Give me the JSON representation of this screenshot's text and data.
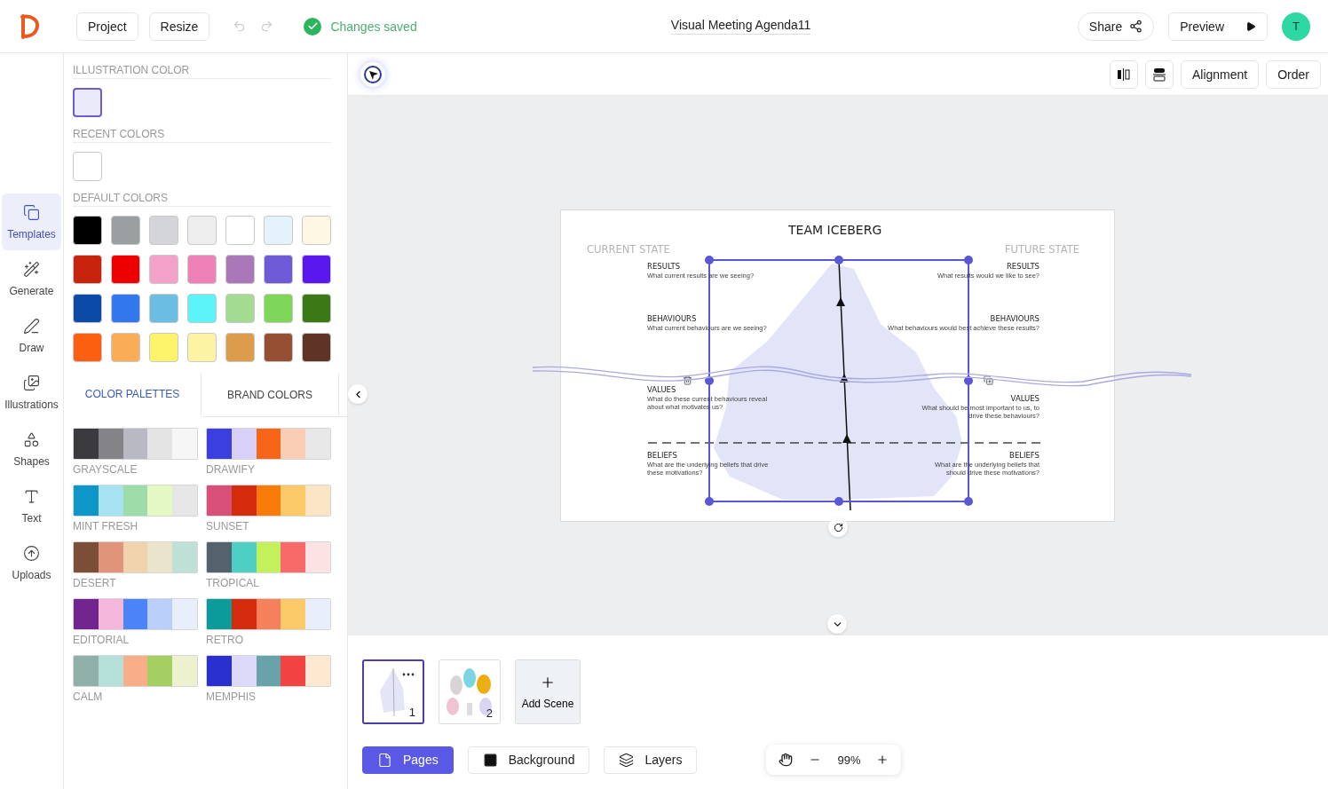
{
  "header": {
    "project_button": "Project",
    "resize_button": "Resize",
    "status": "Changes saved",
    "document_title": "Visual Meeting Agenda11",
    "share_button": "Share",
    "preview_button": "Preview",
    "avatar": "T"
  },
  "sidebar": {
    "items": [
      {
        "label": "Templates",
        "selected": true
      },
      {
        "label": "Generate",
        "selected": false
      },
      {
        "label": "Draw",
        "selected": false
      },
      {
        "label": "Illustrations",
        "selected": false
      },
      {
        "label": "Shapes",
        "selected": false
      },
      {
        "label": "Text",
        "selected": false
      },
      {
        "label": "Uploads",
        "selected": false
      }
    ]
  },
  "color_panel": {
    "illustration_heading": "ILLUSTRATION COLOR",
    "illustration_colors": [
      {
        "color": "#e9e9f9"
      }
    ],
    "recent_heading": "RECENT COLORS",
    "recent_colors": [
      {
        "color": "#ffffff"
      }
    ],
    "default_heading": "DEFAULT COLORS",
    "default_colors": [
      {
        "color": "#000000"
      },
      {
        "color": "#9aa0a2"
      },
      {
        "color": "#d3d5d8"
      },
      {
        "color": "#eeeeee"
      },
      {
        "color": "#ffffff"
      },
      {
        "color": "#e3f2fb"
      },
      {
        "color": "#fdf7e4"
      },
      {
        "color": "#c8230c"
      },
      {
        "color": "#ee0000"
      },
      {
        "color": "#f2a2c8"
      },
      {
        "color": "#ee82b8"
      },
      {
        "color": "#aa78b8"
      },
      {
        "color": "#6e5ad6"
      },
      {
        "color": "#5a17ee"
      },
      {
        "color": "#0c4aa8"
      },
      {
        "color": "#3277ee"
      },
      {
        "color": "#6cbde2"
      },
      {
        "color": "#5cf4f8"
      },
      {
        "color": "#a3dc90"
      },
      {
        "color": "#7ed758"
      },
      {
        "color": "#3b7816"
      },
      {
        "color": "#fc5f0f"
      },
      {
        "color": "#fbac57"
      },
      {
        "color": "#fdf36b"
      },
      {
        "color": "#fdf3a5"
      },
      {
        "color": "#dc9c4c"
      },
      {
        "color": "#955033"
      },
      {
        "color": "#603327"
      }
    ],
    "tabs": [
      {
        "label": "COLOR PALETTES",
        "selected": true
      },
      {
        "label": "BRAND COLORS",
        "selected": false
      }
    ],
    "palettes": [
      {
        "name": "GRAYSCALE",
        "colors": [
          {
            "color": "#3b3b3f"
          },
          {
            "color": "#848488"
          },
          {
            "color": "#b9b9c3"
          },
          {
            "color": "#e4e4e4"
          },
          {
            "color": "#f6f6f6"
          }
        ]
      },
      {
        "name": "DRAWIFY",
        "colors": [
          {
            "color": "#3b3fe0"
          },
          {
            "color": "#d8d0f8"
          },
          {
            "color": "#f76518"
          },
          {
            "color": "#f9ccb4"
          },
          {
            "color": "#e8e8e8"
          }
        ]
      },
      {
        "name": "MINT FRESH",
        "colors": [
          {
            "color": "#0d96c8"
          },
          {
            "color": "#a6e2f2"
          },
          {
            "color": "#9ddba8"
          },
          {
            "color": "#e4f8c4"
          },
          {
            "color": "#e6e6e6"
          }
        ]
      },
      {
        "name": "SUNSET",
        "colors": [
          {
            "color": "#d8507a"
          },
          {
            "color": "#d42b0d"
          },
          {
            "color": "#f97c0b"
          },
          {
            "color": "#fbc965"
          },
          {
            "color": "#fce5c4"
          }
        ]
      },
      {
        "name": "DESERT",
        "colors": [
          {
            "color": "#7a4e37"
          },
          {
            "color": "#e0957b"
          },
          {
            "color": "#f0d2ad"
          },
          {
            "color": "#ebe4cc"
          },
          {
            "color": "#bfe0d6"
          }
        ]
      },
      {
        "name": "TROPICAL",
        "colors": [
          {
            "color": "#56616e"
          },
          {
            "color": "#4ecfc4"
          },
          {
            "color": "#c4f05c"
          },
          {
            "color": "#f86a6a"
          },
          {
            "color": "#fbe3e3"
          }
        ]
      },
      {
        "name": "EDITORIAL",
        "colors": [
          {
            "color": "#72258e"
          },
          {
            "color": "#f4b6d9"
          },
          {
            "color": "#4b84f8"
          },
          {
            "color": "#b9cff9"
          },
          {
            "color": "#e8effa"
          }
        ]
      },
      {
        "name": "RETRO",
        "colors": [
          {
            "color": "#0b9b9b"
          },
          {
            "color": "#d42b0d"
          },
          {
            "color": "#f7805c"
          },
          {
            "color": "#fbc965"
          },
          {
            "color": "#e8effa"
          }
        ]
      },
      {
        "name": "CALM",
        "colors": [
          {
            "color": "#8fb0a8"
          },
          {
            "color": "#b5e0d9"
          },
          {
            "color": "#f9ad88"
          },
          {
            "color": "#a6cf61"
          },
          {
            "color": "#eef1ce"
          }
        ]
      },
      {
        "name": "MEMPHIS",
        "colors": [
          {
            "color": "#2a2fcf"
          },
          {
            "color": "#dcdaf8"
          },
          {
            "color": "#6aa2aa"
          },
          {
            "color": "#f24343"
          },
          {
            "color": "#fde8d0"
          }
        ]
      }
    ]
  },
  "toolbar": {
    "buttons": [
      "Alignment",
      "Order"
    ]
  },
  "slide": {
    "title": "TEAM ICEBERG",
    "left_heading": "CURRENT STATE",
    "right_heading": "FUTURE STATE",
    "left_items": [
      {
        "label": "RESULTS",
        "question": "What current results are we seeing?"
      },
      {
        "label": "BEHAVIOURS",
        "question": "What current behaviours are we seeing?"
      },
      {
        "label": "VALUES",
        "question": "What do these current behaviours reveal about what motivates us?"
      },
      {
        "label": "BELIEFS",
        "question": "What are the underlying beliefs that drive these motivations?"
      }
    ],
    "right_items": [
      {
        "label": "RESULTS",
        "question": "What results would we like to see?"
      },
      {
        "label": "BEHAVIOURS",
        "question": "What behaviours would best achieve these results?"
      },
      {
        "label": "VALUES",
        "question": "What should be most important to us, to drive these behaviours?"
      },
      {
        "label": "BELIEFS",
        "question": "What are the underlying beliefs that should drive these motivations?"
      }
    ]
  },
  "scenes": [
    {
      "number": "1",
      "selected": true
    },
    {
      "number": "2",
      "selected": false
    }
  ],
  "add_scene": "Add Scene",
  "bottom_tabs": [
    {
      "label": "Pages",
      "selected": true
    },
    {
      "label": "Background",
      "selected": false
    },
    {
      "label": "Layers",
      "selected": false
    }
  ],
  "zoom": "99%"
}
